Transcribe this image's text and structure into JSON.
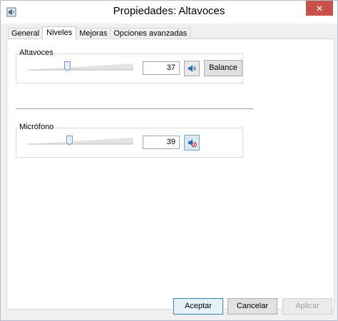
{
  "window": {
    "title": "Propiedades: Altavoces",
    "close_glyph": "✕"
  },
  "tabs": [
    {
      "label": "General",
      "active": false
    },
    {
      "label": "Niveles",
      "active": true
    },
    {
      "label": "Mejoras",
      "active": false
    },
    {
      "label": "Opciones avanzadas",
      "active": false
    }
  ],
  "levels": {
    "speakers": {
      "label": "Altavoces",
      "value": "37",
      "level": 37,
      "icon": "speaker-icon",
      "balance_label": "Balance"
    },
    "microphone": {
      "label": "Micrófono",
      "value": "39",
      "level": 39,
      "icon": "speaker-muted-icon"
    }
  },
  "footer": {
    "ok_label": "Aceptar",
    "cancel_label": "Cancelar",
    "apply_label": "Aplicar"
  },
  "colors": {
    "close": "#c7504a",
    "default_border": "#3c7fb1",
    "muted_bg": "#d9eaf7"
  }
}
